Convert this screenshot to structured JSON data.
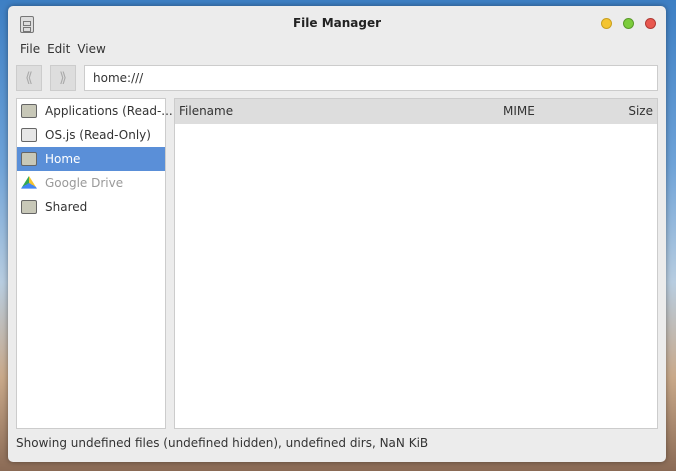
{
  "window": {
    "title": "File Manager"
  },
  "menu": [
    "File",
    "Edit",
    "View"
  ],
  "toolbar": {
    "back": "back",
    "forward": "forward",
    "address": "home:///"
  },
  "sidebar": [
    {
      "label": "Applications (Read-...",
      "icon": "folder-star-icon"
    },
    {
      "label": "OS.js (Read-Only)",
      "icon": "drive-icon"
    },
    {
      "label": "Home",
      "icon": "folder-home-icon",
      "selected": true
    },
    {
      "label": "Google Drive",
      "icon": "google-drive-icon",
      "disabled": true
    },
    {
      "label": "Shared",
      "icon": "folder-shared-icon"
    }
  ],
  "columns": {
    "filename": "Filename",
    "mime": "MIME",
    "size": "Size"
  },
  "status": "Showing undefined files (undefined hidden), undefined dirs, NaN KiB",
  "colors": {
    "accent": "#5a8fd8",
    "minimize": "#f4c430",
    "maximize": "#7ccc3c",
    "close": "#e8584f"
  }
}
